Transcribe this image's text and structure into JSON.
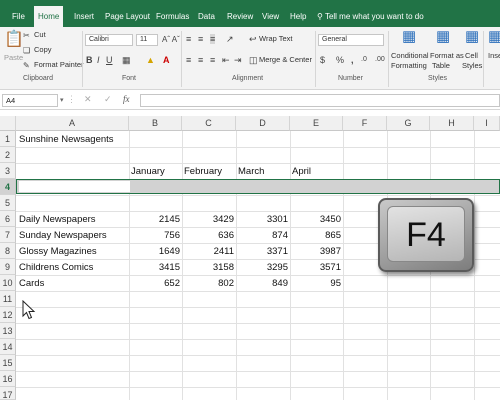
{
  "menu": {
    "tabs": [
      "File",
      "Home",
      "Insert",
      "Page Layout",
      "Formulas",
      "Data",
      "Review",
      "View",
      "Help"
    ],
    "active_tab": "Home",
    "tell_me": "Tell me what you want to do"
  },
  "ribbon": {
    "clipboard": {
      "paste": "Paste",
      "cut": "Cut",
      "copy": "Copy",
      "format_painter": "Format Painter",
      "label": "Clipboard"
    },
    "font": {
      "name": "Calibri",
      "size": "11",
      "label": "Font"
    },
    "alignment": {
      "wrap_text": "Wrap Text",
      "merge_center": "Merge & Center",
      "label": "Alignment"
    },
    "number": {
      "format": "General",
      "label": "Number"
    },
    "styles": {
      "conditional_formatting": [
        "Conditional",
        "Formatting"
      ],
      "format_as_table": [
        "Format as",
        "Table"
      ],
      "cell_styles": [
        "Cell",
        "Styles"
      ],
      "insert": "Inse",
      "label": "Styles"
    }
  },
  "formula_bar": {
    "name_box": "A4",
    "fx": "fx",
    "content": ""
  },
  "columns": [
    "A",
    "B",
    "C",
    "D",
    "E",
    "F",
    "G",
    "H",
    "I"
  ],
  "rows": [
    "1",
    "2",
    "3",
    "4",
    "5",
    "6",
    "7",
    "8",
    "9",
    "10",
    "11",
    "12",
    "13",
    "14",
    "15",
    "16",
    "17"
  ],
  "sheet": {
    "title": "Sunshine Newsagents",
    "months": [
      "January",
      "February",
      "March",
      "April"
    ],
    "data_rows": [
      {
        "label": "Daily Newspapers",
        "values": [
          "2145",
          "3429",
          "3301",
          "3450"
        ]
      },
      {
        "label": "Sunday Newspapers",
        "values": [
          "756",
          "636",
          "874",
          "865"
        ]
      },
      {
        "label": "Glossy Magazines",
        "values": [
          "1649",
          "2411",
          "3371",
          "3987"
        ]
      },
      {
        "label": "Childrens Comics",
        "values": [
          "3415",
          "3158",
          "3295",
          "3571"
        ]
      },
      {
        "label": "Cards",
        "values": [
          "652",
          "802",
          "849",
          "95"
        ]
      }
    ]
  },
  "overlay": {
    "key_label": "F4"
  }
}
